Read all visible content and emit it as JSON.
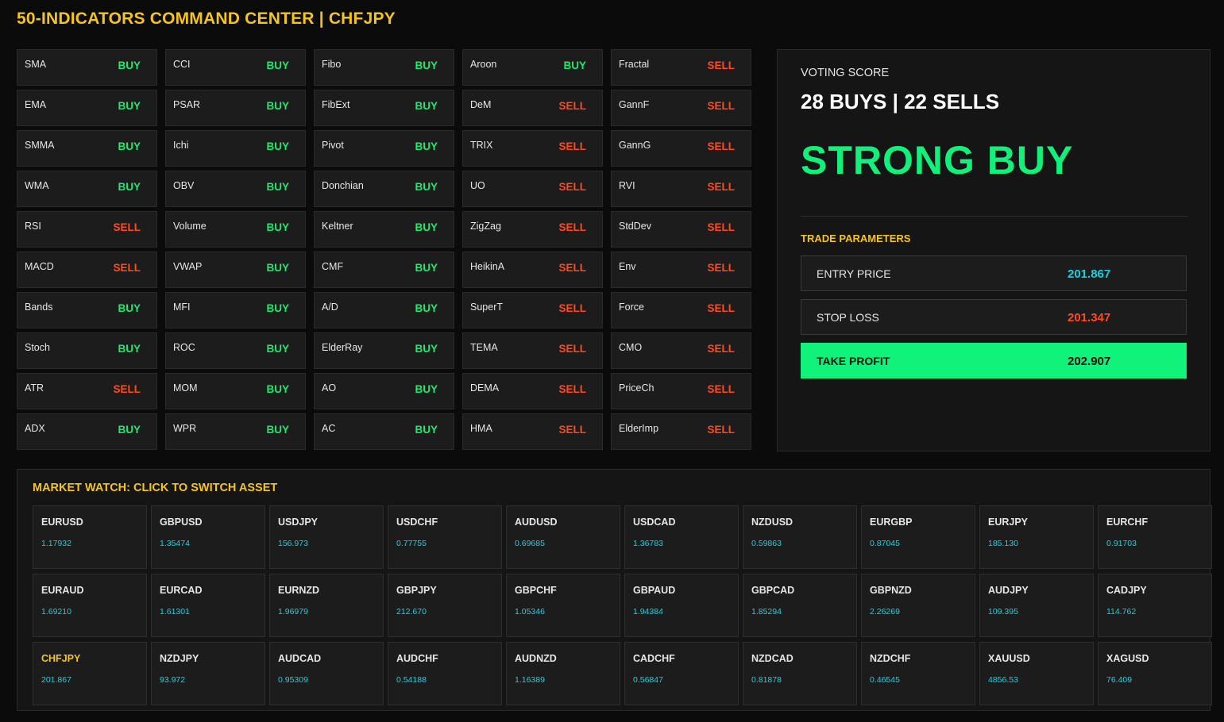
{
  "header": {
    "title": "50-INDICATORS COMMAND CENTER | CHFJPY"
  },
  "indicators": [
    [
      {
        "name": "SMA",
        "signal": "BUY"
      },
      {
        "name": "EMA",
        "signal": "BUY"
      },
      {
        "name": "SMMA",
        "signal": "BUY"
      },
      {
        "name": "WMA",
        "signal": "BUY"
      },
      {
        "name": "RSI",
        "signal": "SELL"
      },
      {
        "name": "MACD",
        "signal": "SELL"
      },
      {
        "name": "Bands",
        "signal": "BUY"
      },
      {
        "name": "Stoch",
        "signal": "BUY"
      },
      {
        "name": "ATR",
        "signal": "SELL"
      },
      {
        "name": "ADX",
        "signal": "BUY"
      }
    ],
    [
      {
        "name": "CCI",
        "signal": "BUY"
      },
      {
        "name": "PSAR",
        "signal": "BUY"
      },
      {
        "name": "Ichi",
        "signal": "BUY"
      },
      {
        "name": "OBV",
        "signal": "BUY"
      },
      {
        "name": "Volume",
        "signal": "BUY"
      },
      {
        "name": "VWAP",
        "signal": "BUY"
      },
      {
        "name": "MFI",
        "signal": "BUY"
      },
      {
        "name": "ROC",
        "signal": "BUY"
      },
      {
        "name": "MOM",
        "signal": "BUY"
      },
      {
        "name": "WPR",
        "signal": "BUY"
      }
    ],
    [
      {
        "name": "Fibo",
        "signal": "BUY"
      },
      {
        "name": "FibExt",
        "signal": "BUY"
      },
      {
        "name": "Pivot",
        "signal": "BUY"
      },
      {
        "name": "Donchian",
        "signal": "BUY"
      },
      {
        "name": "Keltner",
        "signal": "BUY"
      },
      {
        "name": "CMF",
        "signal": "BUY"
      },
      {
        "name": "A/D",
        "signal": "BUY"
      },
      {
        "name": "ElderRay",
        "signal": "BUY"
      },
      {
        "name": "AO",
        "signal": "BUY"
      },
      {
        "name": "AC",
        "signal": "BUY"
      }
    ],
    [
      {
        "name": "Aroon",
        "signal": "BUY"
      },
      {
        "name": "DeM",
        "signal": "SELL"
      },
      {
        "name": "TRIX",
        "signal": "SELL"
      },
      {
        "name": "UO",
        "signal": "SELL"
      },
      {
        "name": "ZigZag",
        "signal": "SELL"
      },
      {
        "name": "HeikinA",
        "signal": "SELL"
      },
      {
        "name": "SuperT",
        "signal": "SELL"
      },
      {
        "name": "TEMA",
        "signal": "SELL"
      },
      {
        "name": "DEMA",
        "signal": "SELL"
      },
      {
        "name": "HMA",
        "signal": "SELL"
      }
    ],
    [
      {
        "name": "Fractal",
        "signal": "SELL"
      },
      {
        "name": "GannF",
        "signal": "SELL"
      },
      {
        "name": "GannG",
        "signal": "SELL"
      },
      {
        "name": "RVI",
        "signal": "SELL"
      },
      {
        "name": "StdDev",
        "signal": "SELL"
      },
      {
        "name": "Env",
        "signal": "SELL"
      },
      {
        "name": "Force",
        "signal": "SELL"
      },
      {
        "name": "CMO",
        "signal": "SELL"
      },
      {
        "name": "PriceCh",
        "signal": "SELL"
      },
      {
        "name": "ElderImp",
        "signal": "SELL"
      }
    ]
  ],
  "voting": {
    "label": "VOTING SCORE",
    "score": "28 BUYS | 22 SELLS",
    "verdict": "STRONG BUY"
  },
  "trade_params": {
    "heading": "TRADE PARAMETERS",
    "entry": {
      "label": "ENTRY PRICE",
      "value": "201.867"
    },
    "stop": {
      "label": "STOP LOSS",
      "value": "201.347"
    },
    "take": {
      "label": "TAKE PROFIT",
      "value": "202.907"
    }
  },
  "market_watch": {
    "heading": "MARKET WATCH: CLICK TO SWITCH ASSET",
    "active": "CHFJPY",
    "rows": [
      [
        {
          "symbol": "EURUSD",
          "price": "1.17932"
        },
        {
          "symbol": "GBPUSD",
          "price": "1.35474"
        },
        {
          "symbol": "USDJPY",
          "price": "156.973"
        },
        {
          "symbol": "USDCHF",
          "price": "0.77755"
        },
        {
          "symbol": "AUDUSD",
          "price": "0.69685"
        },
        {
          "symbol": "USDCAD",
          "price": "1.36783"
        },
        {
          "symbol": "NZDUSD",
          "price": "0.59863"
        },
        {
          "symbol": "EURGBP",
          "price": "0.87045"
        },
        {
          "symbol": "EURJPY",
          "price": "185.130"
        },
        {
          "symbol": "EURCHF",
          "price": "0.91703"
        }
      ],
      [
        {
          "symbol": "EURAUD",
          "price": "1.69210"
        },
        {
          "symbol": "EURCAD",
          "price": "1.61301"
        },
        {
          "symbol": "EURNZD",
          "price": "1.96979"
        },
        {
          "symbol": "GBPJPY",
          "price": "212.670"
        },
        {
          "symbol": "GBPCHF",
          "price": "1.05346"
        },
        {
          "symbol": "GBPAUD",
          "price": "1.94384"
        },
        {
          "symbol": "GBPCAD",
          "price": "1.85294"
        },
        {
          "symbol": "GBPNZD",
          "price": "2.26269"
        },
        {
          "symbol": "AUDJPY",
          "price": "109.395"
        },
        {
          "symbol": "CADJPY",
          "price": "114.762"
        }
      ],
      [
        {
          "symbol": "CHFJPY",
          "price": "201.867"
        },
        {
          "symbol": "NZDJPY",
          "price": "93.972"
        },
        {
          "symbol": "AUDCAD",
          "price": "0.95309"
        },
        {
          "symbol": "AUDCHF",
          "price": "0.54188"
        },
        {
          "symbol": "AUDNZD",
          "price": "1.16389"
        },
        {
          "symbol": "CADCHF",
          "price": "0.56847"
        },
        {
          "symbol": "NZDCAD",
          "price": "0.81878"
        },
        {
          "symbol": "NZDCHF",
          "price": "0.46545"
        },
        {
          "symbol": "XAUUSD",
          "price": "4856.53"
        },
        {
          "symbol": "XAGUSD",
          "price": "76.409"
        }
      ]
    ]
  },
  "colors": {
    "buy": "#1ee86f",
    "sell": "#ff4a1c",
    "accent": "#f5c518",
    "entry": "#18d0e0",
    "stop": "#ff4a1c",
    "take_bg": "#10f27a",
    "price": "#18d0e0"
  }
}
